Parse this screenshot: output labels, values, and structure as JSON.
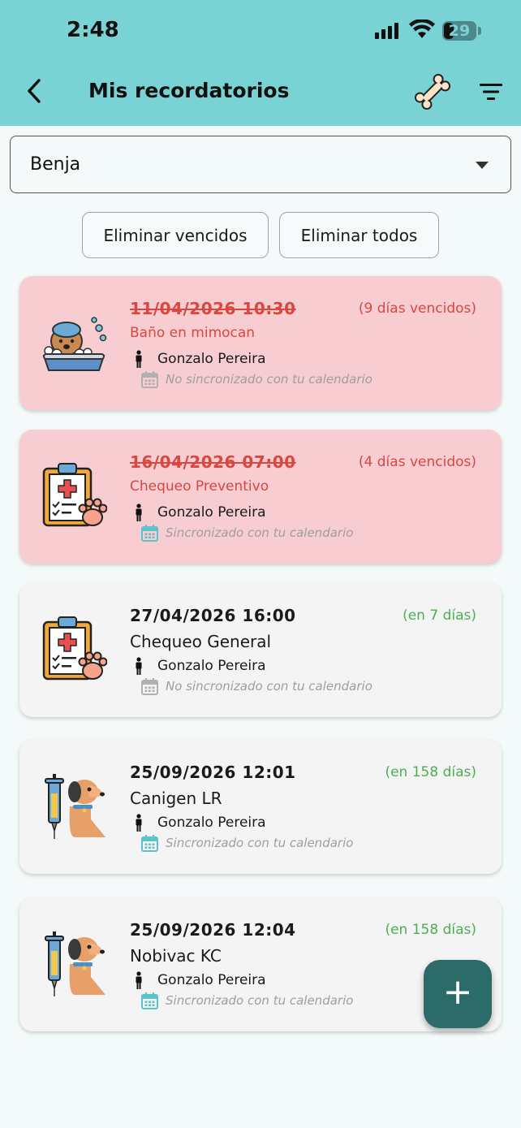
{
  "status_bar": {
    "time": "2:48",
    "battery": "29"
  },
  "header": {
    "title": "Mis recordatorios"
  },
  "pet_selector": {
    "value": "Benja"
  },
  "actions": {
    "delete_expired": "Eliminar vencidos",
    "delete_all": "Eliminar todos"
  },
  "reminders": [
    {
      "date": "11/04/2026 10:30",
      "relative": "(9 días vencidos)",
      "title": "Baño en mimocan",
      "owner": "Gonzalo Pereira",
      "calendar": "No sincronizado con tu calendario",
      "status": "overdue",
      "icon": "dog-bath-icon"
    },
    {
      "date": "16/04/2026 07:00",
      "relative": "(4 días vencidos)",
      "title": "Chequeo Preventivo",
      "owner": "Gonzalo Pereira",
      "calendar": "Sincronizado con tu calendario",
      "status": "overdue",
      "icon": "vet-checkup-icon"
    },
    {
      "date": "27/04/2026 16:00",
      "relative": "(en 7 días)",
      "title": "Chequeo General",
      "owner": "Gonzalo Pereira",
      "calendar": "No sincronizado con tu calendario",
      "status": "upcoming",
      "icon": "vet-checkup-icon"
    },
    {
      "date": "25/09/2026 12:01",
      "relative": "(en 158 días)",
      "title": "Canigen LR",
      "owner": "Gonzalo Pereira",
      "calendar": "Sincronizado con tu calendario",
      "status": "upcoming",
      "icon": "dog-vaccine-icon"
    },
    {
      "date": "25/09/2026 12:04",
      "relative": "(en 158 días)",
      "title": "Nobivac KC",
      "owner": "Gonzalo Pereira",
      "calendar": "Sincronizado con tu calendario",
      "status": "upcoming",
      "icon": "dog-vaccine-icon"
    }
  ],
  "colors": {
    "header": "#79d2d4",
    "overdue_card": "#f7cdd2",
    "overdue_text": "#d9473f",
    "upcoming_relative": "#4caf50",
    "fab": "#2b6b69"
  }
}
